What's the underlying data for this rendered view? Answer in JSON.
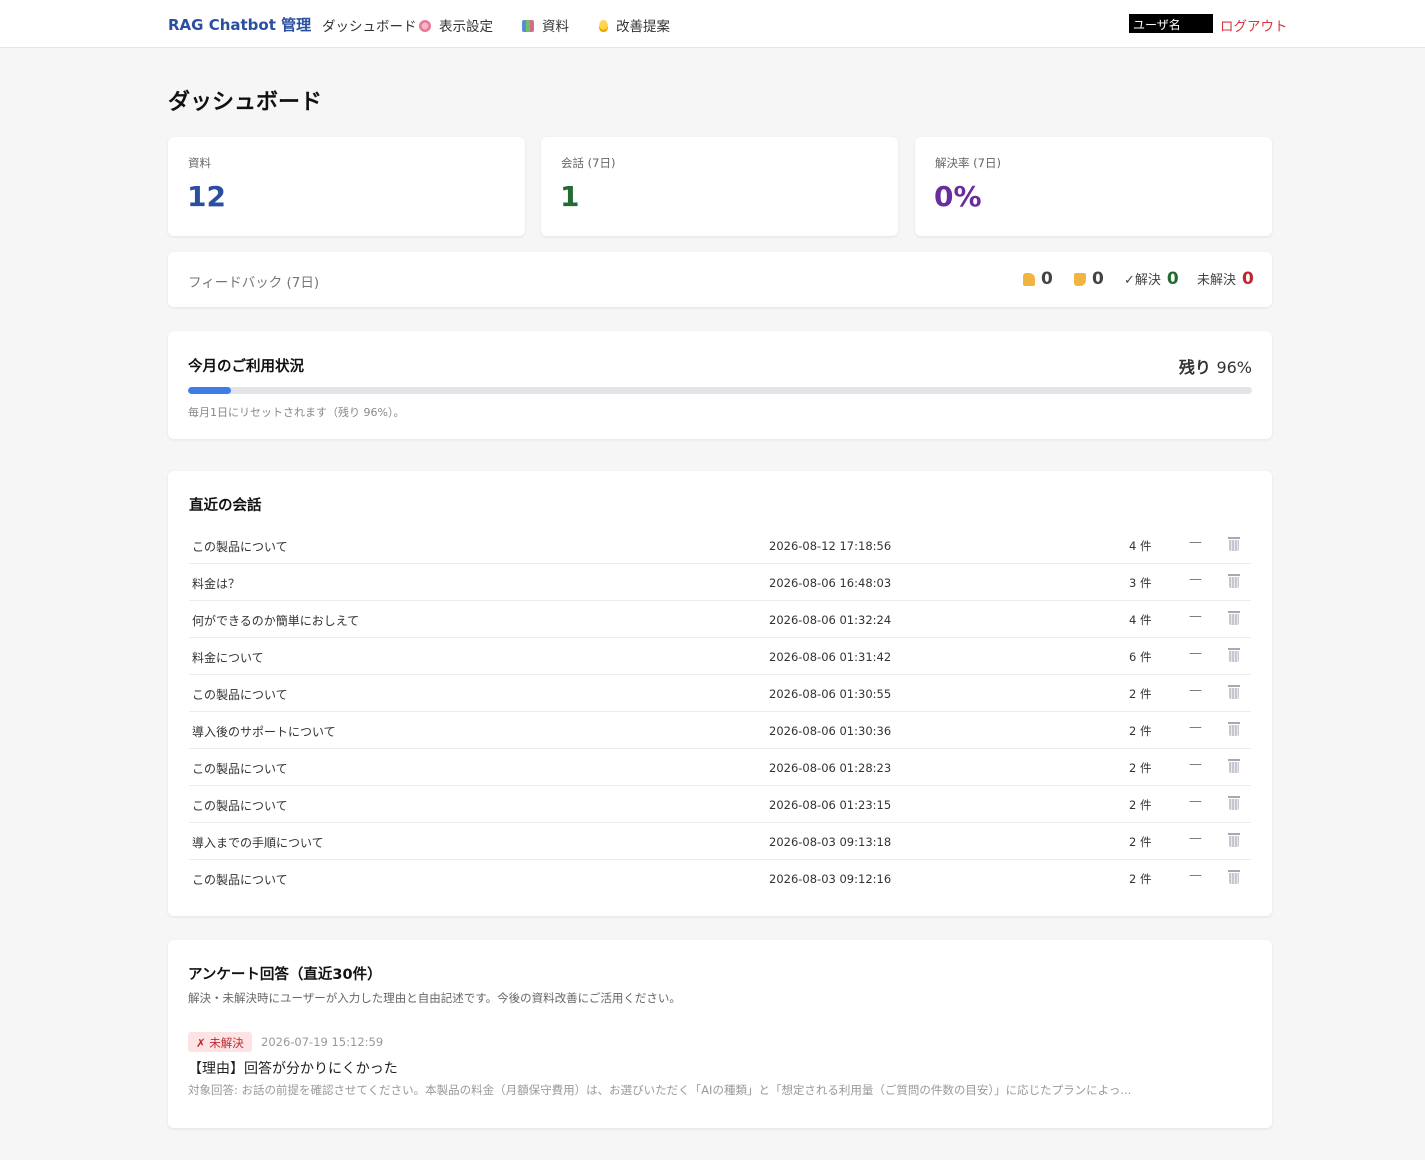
{
  "nav": {
    "brand": "RAG Chatbot 管理",
    "links": [
      {
        "label": "ダッシュボード",
        "icon": ""
      },
      {
        "label": "表示設定",
        "icon": "flower-icon"
      },
      {
        "label": "資料",
        "icon": "books-icon"
      },
      {
        "label": "改善提案",
        "icon": "bulb-icon"
      }
    ],
    "username": "ユーザ名",
    "logout": "ログアウト"
  },
  "page_title": "ダッシュボード",
  "stats": [
    {
      "label": "資料",
      "value": "12",
      "color": "#2a4fa0"
    },
    {
      "label": "会話 (7日)",
      "value": "1",
      "color": "#236b33"
    },
    {
      "label": "解決率 (7日)",
      "value": "0%",
      "color": "#6a2c9e"
    }
  ],
  "feedback": {
    "title": "フィードバック (7日)",
    "thumbs_up": "0",
    "thumbs_down": "0",
    "resolved_label": "✓解決",
    "resolved": "0",
    "unresolved_label": "未解決",
    "unresolved": "0"
  },
  "usage": {
    "title": "今月のご利用状況",
    "remaining_label": "残り",
    "remaining_value": "96%",
    "used_fraction": 0.04,
    "note": "毎月1日にリセットされます（残り 96%）。"
  },
  "recent": {
    "title": "直近の会話",
    "rows": [
      {
        "title": "この製品について",
        "date": "2026-08-12 17:18:56",
        "count": "4 件",
        "status": "—"
      },
      {
        "title": "料金は？",
        "date": "2026-08-06 16:48:03",
        "count": "3 件",
        "status": "—"
      },
      {
        "title": "何ができるのか簡単におしえて",
        "date": "2026-08-06 01:32:24",
        "count": "4 件",
        "status": "—"
      },
      {
        "title": "料金について",
        "date": "2026-08-06 01:31:42",
        "count": "6 件",
        "status": "—"
      },
      {
        "title": "この製品について",
        "date": "2026-08-06 01:30:55",
        "count": "2 件",
        "status": "—"
      },
      {
        "title": "導入後のサポートについて",
        "date": "2026-08-06 01:30:36",
        "count": "2 件",
        "status": "—"
      },
      {
        "title": "この製品について",
        "date": "2026-08-06 01:28:23",
        "count": "2 件",
        "status": "—"
      },
      {
        "title": "この製品について",
        "date": "2026-08-06 01:23:15",
        "count": "2 件",
        "status": "—"
      },
      {
        "title": "導入までの手順について",
        "date": "2026-08-03 09:13:18",
        "count": "2 件",
        "status": "—"
      },
      {
        "title": "この製品について",
        "date": "2026-08-03 09:12:16",
        "count": "2 件",
        "status": "—"
      }
    ]
  },
  "survey": {
    "title": "アンケート回答（直近30件）",
    "subtitle": "解決・未解決時にユーザーが入力した理由と自由記述です。今後の資料改善にご活用ください。",
    "entries": [
      {
        "badge": "✗ 未解決",
        "date": "2026-07-19 15:12:59",
        "reason": "【理由】回答が分かりにくかった",
        "target": "対象回答: お話の前提を確認させてください。本製品の料金（月額保守費用）は、お選びいただく「AIの種類」と「想定される利用量（ご質問の件数の目安）」に応じたプランによっ..."
      }
    ]
  }
}
